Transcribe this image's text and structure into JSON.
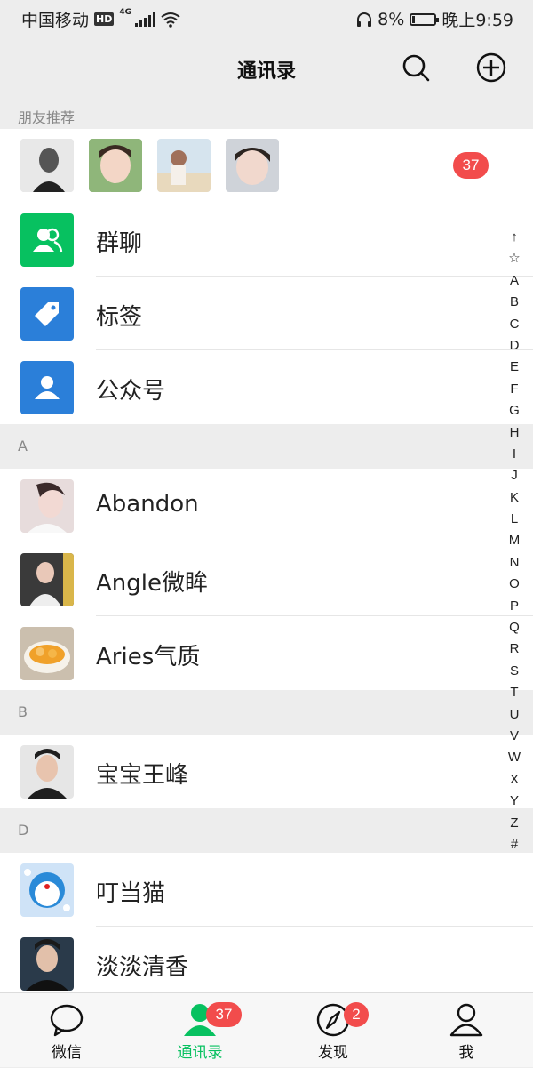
{
  "status_bar": {
    "carrier": "中国移动",
    "hd": "HD",
    "network": "4G",
    "battery": "8%",
    "time": "晚上9:59"
  },
  "header": {
    "title": "通讯录"
  },
  "friend_recommend": {
    "label": "朋友推荐",
    "badge": "37"
  },
  "features": [
    {
      "label": "群聊"
    },
    {
      "label": "标签"
    },
    {
      "label": "公众号"
    }
  ],
  "sections": [
    {
      "letter": "A",
      "contacts": [
        "Abandon",
        "Angle微眸",
        "Aries气质"
      ]
    },
    {
      "letter": "B",
      "contacts": [
        "宝宝王峰"
      ]
    },
    {
      "letter": "D",
      "contacts": [
        "叮当猫",
        "淡淡清香"
      ]
    }
  ],
  "index_letters": [
    "↑",
    "☆",
    "A",
    "B",
    "C",
    "D",
    "E",
    "F",
    "G",
    "H",
    "I",
    "J",
    "K",
    "L",
    "M",
    "N",
    "O",
    "P",
    "Q",
    "R",
    "S",
    "T",
    "U",
    "V",
    "W",
    "X",
    "Y",
    "Z",
    "#"
  ],
  "tabs": [
    {
      "label": "微信",
      "badge": ""
    },
    {
      "label": "通讯录",
      "badge": "37"
    },
    {
      "label": "发现",
      "badge": "2"
    },
    {
      "label": "我",
      "badge": ""
    }
  ],
  "colors": {
    "accent": "#07c160",
    "badge": "#f24c4c",
    "tile_blue": "#2b7fd9"
  }
}
